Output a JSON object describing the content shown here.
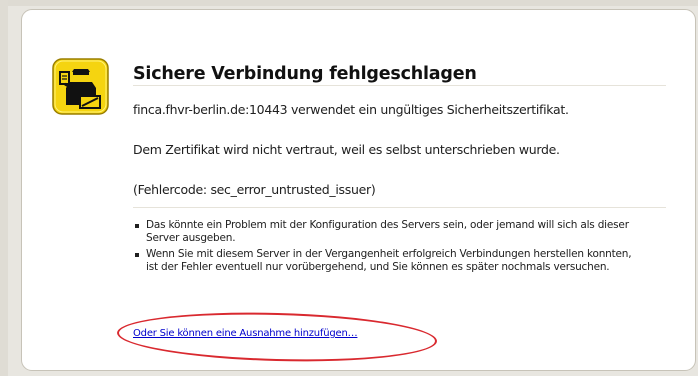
{
  "page": {
    "title": "Sichere Verbindung fehlgeschlagen",
    "message": "finca.fhvr-berlin.de:10443 verwendet ein ungültiges Sicherheitszertifikat.",
    "reason": "Dem Zertifikat wird nicht vertraut, weil es selbst unterschrieben wurde.",
    "error_code": "(Fehlercode: sec_error_untrusted_issuer)"
  },
  "bullets": [
    {
      "text": "Das könnte ein Problem mit der Konfiguration des Servers sein, oder jemand will sich als dieser Server ausgeben."
    },
    {
      "text": "Wenn Sie mit diesem Server in der Vergangenheit erfolgreich Verbindungen herstellen konnten, ist der Fehler eventuell nur vorübergehend, und Sie können es später nochmals versuchen."
    }
  ],
  "exception_link": "Oder Sie können eine Ausnahme hinzufügen…",
  "icon": "security-officer-icon",
  "colors": {
    "icon_background": "#f5d410",
    "link": "#0000cc",
    "annotation": "#d9292f"
  }
}
